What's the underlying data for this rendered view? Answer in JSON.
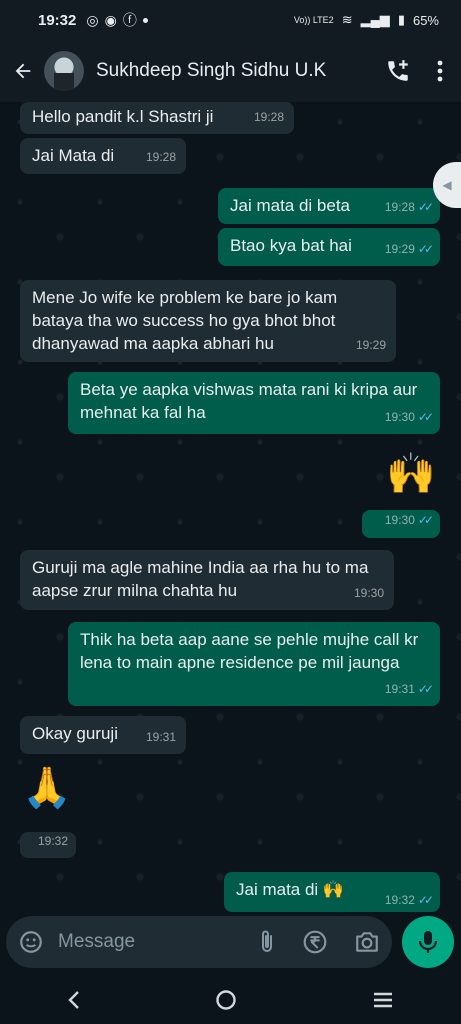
{
  "status": {
    "time": "19:32",
    "battery": "65%",
    "network": "Vo)) LTE2"
  },
  "header": {
    "contact_name": "Sukhdeep Singh Sidhu U.K"
  },
  "messages": [
    {
      "dir": "in",
      "text": "Hello pandit k.l Shastri ji",
      "time": "19:28"
    },
    {
      "dir": "in",
      "text": "Jai Mata di",
      "time": "19:28"
    },
    {
      "dir": "out",
      "text": "Jai mata di beta",
      "time": "19:28"
    },
    {
      "dir": "out",
      "text": "Btao kya bat hai",
      "time": "19:29"
    },
    {
      "dir": "in",
      "text": "Mene Jo wife ke problem ke bare jo kam bataya tha wo success ho gya bhot bhot dhanyawad ma aapka abhari hu",
      "time": "19:29"
    },
    {
      "dir": "out",
      "text": "Beta ye aapka vishwas mata rani ki kripa aur mehnat ka fal ha",
      "time": "19:30"
    },
    {
      "dir": "out",
      "text": "🙌",
      "time": "19:30"
    },
    {
      "dir": "in",
      "text": "Guruji ma agle mahine India aa rha hu to ma aapse zrur milna chahta hu",
      "time": "19:30"
    },
    {
      "dir": "out",
      "text": "Thik ha beta aap aane se pehle mujhe call kr lena to main apne residence pe mil jaunga",
      "time": "19:31"
    },
    {
      "dir": "in",
      "text": "Okay guruji",
      "time": "19:31"
    },
    {
      "dir": "in",
      "text": "🙏",
      "time": "19:32"
    },
    {
      "dir": "out",
      "text": "Jai mata di 🙌",
      "time": "19:32"
    }
  ],
  "composer": {
    "placeholder": "Message"
  },
  "colors": {
    "incoming": "#202c33",
    "outgoing": "#005c4b",
    "accent": "#00a884",
    "tick": "#53bdeb"
  }
}
